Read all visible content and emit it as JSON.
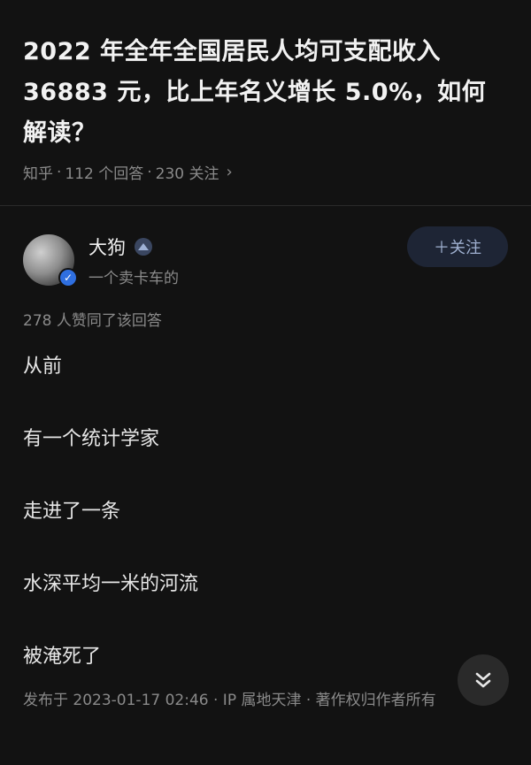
{
  "question": {
    "title": "2022 年全年全国居民人均可支配收入 36883 元，比上年名义增长 5.0%，如何解读？",
    "source": "知乎",
    "answers": "112 个回答",
    "followers": "230 关注"
  },
  "answer": {
    "author_name": "大狗",
    "author_desc": "一个卖卡车的",
    "follow_label": "＋关注",
    "likes": "278 人赞同了该回答",
    "paragraphs": [
      "从前",
      "有一个统计学家",
      "走进了一条",
      "水深平均一米的河流",
      "被淹死了"
    ],
    "footer": "发布于 2023-01-17 02:46 · IP 属地天津 · 著作权归作者所有"
  },
  "icons": {
    "verified": "verified-check-icon",
    "badge": "creator-badge-icon",
    "chevron": "chevron-right-icon",
    "scroll": "double-chevron-down-icon"
  },
  "colors": {
    "background": "#121212",
    "accent": "#2f6fe0",
    "muted": "#8a8a8a"
  }
}
